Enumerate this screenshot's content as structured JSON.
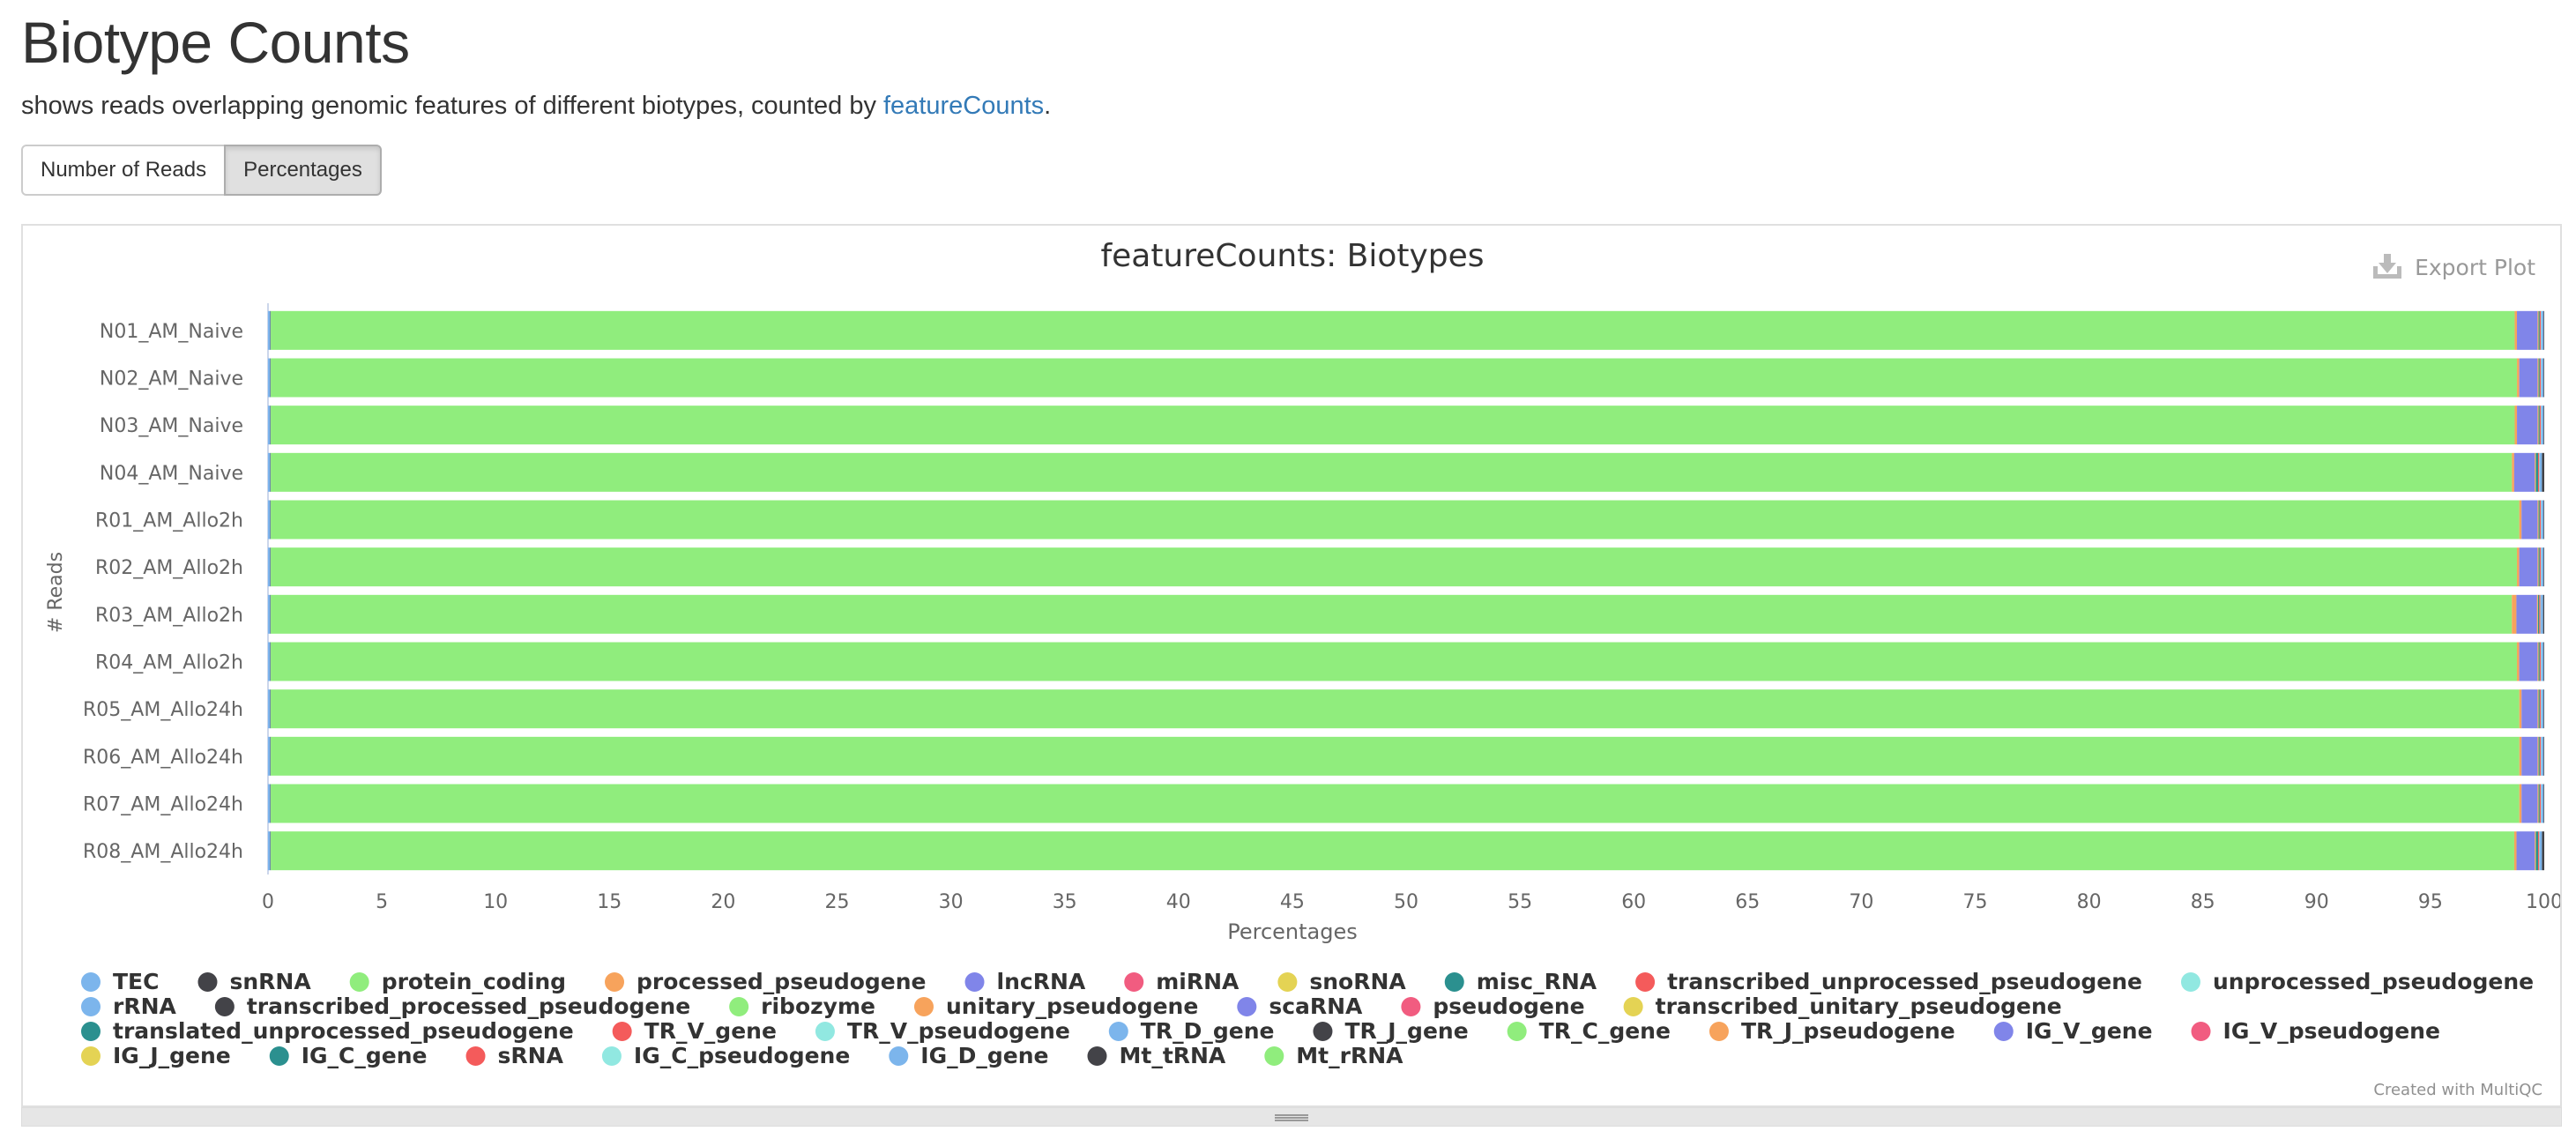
{
  "page": {
    "title": "Biotype Counts",
    "description_prefix": "shows reads overlapping genomic features of different biotypes, counted by ",
    "description_link": "featureCounts",
    "description_suffix": ".",
    "buttons": {
      "reads": "Number of Reads",
      "percentages": "Percentages"
    },
    "export_label": "Export Plot",
    "credit": "Created with MultiQC"
  },
  "chart_data": {
    "type": "bar",
    "orientation": "horizontal",
    "stacked": true,
    "title": "featureCounts: Biotypes",
    "xlabel": "Percentages",
    "ylabel": "# Reads",
    "xlim": [
      0,
      100
    ],
    "xticks": [
      0,
      5,
      10,
      15,
      20,
      25,
      30,
      35,
      40,
      45,
      50,
      55,
      60,
      65,
      70,
      75,
      80,
      85,
      90,
      95,
      100
    ],
    "categories": [
      "N01_AM_Naive",
      "N02_AM_Naive",
      "N03_AM_Naive",
      "N04_AM_Naive",
      "R01_AM_Allo2h",
      "R02_AM_Allo2h",
      "R03_AM_Allo2h",
      "R04_AM_Allo2h",
      "R05_AM_Allo24h",
      "R06_AM_Allo24h",
      "R07_AM_Allo24h",
      "R08_AM_Allo24h"
    ],
    "legend_position": "bottom",
    "series": [
      {
        "name": "TEC",
        "color": "#7cb5ec",
        "values": [
          0.1,
          0.1,
          0.1,
          0.1,
          0.1,
          0.1,
          0.1,
          0.1,
          0.1,
          0.1,
          0.1,
          0.1
        ]
      },
      {
        "name": "snRNA",
        "color": "#434348",
        "values": [
          0.02,
          0.02,
          0.02,
          0.02,
          0.02,
          0.02,
          0.02,
          0.02,
          0.02,
          0.02,
          0.02,
          0.02
        ]
      },
      {
        "name": "protein_coding",
        "color": "#90ed7d",
        "values": [
          98.6,
          98.8,
          98.7,
          98.4,
          98.9,
          98.7,
          98.2,
          98.6,
          99.0,
          99.1,
          99.0,
          98.7
        ]
      },
      {
        "name": "processed_pseudogene",
        "color": "#f7a35c",
        "values": [
          0.1,
          0.1,
          0.1,
          0.1,
          0.1,
          0.1,
          0.2,
          0.1,
          0.1,
          0.1,
          0.1,
          0.1
        ]
      },
      {
        "name": "lncRNA",
        "color": "#8085e9",
        "values": [
          0.9,
          0.8,
          0.9,
          0.9,
          0.7,
          0.8,
          0.9,
          0.8,
          0.7,
          0.7,
          0.7,
          0.8
        ]
      },
      {
        "name": "miRNA",
        "color": "#f15c80",
        "values": [
          0.02,
          0.02,
          0.02,
          0.02,
          0.02,
          0.02,
          0.02,
          0.02,
          0.02,
          0.02,
          0.02,
          0.02
        ]
      },
      {
        "name": "snoRNA",
        "color": "#e4d354",
        "values": [
          0.03,
          0.03,
          0.03,
          0.03,
          0.03,
          0.03,
          0.03,
          0.03,
          0.03,
          0.03,
          0.03,
          0.03
        ]
      },
      {
        "name": "misc_RNA",
        "color": "#2b908f",
        "values": [
          0.05,
          0.05,
          0.05,
          0.1,
          0.05,
          0.05,
          0.05,
          0.05,
          0.05,
          0.05,
          0.05,
          0.1
        ]
      },
      {
        "name": "transcribed_unprocessed_pseudogene",
        "color": "#f45b5b",
        "values": [
          0.05,
          0.05,
          0.05,
          0.05,
          0.05,
          0.05,
          0.05,
          0.05,
          0.05,
          0.05,
          0.05,
          0.05
        ]
      },
      {
        "name": "unprocessed_pseudogene",
        "color": "#91e8e1",
        "values": [
          0.02,
          0.02,
          0.02,
          0.02,
          0.02,
          0.02,
          0.02,
          0.02,
          0.02,
          0.02,
          0.02,
          0.02
        ]
      },
      {
        "name": "rRNA",
        "color": "#7cb5ec",
        "values": [
          0.1,
          0.1,
          0.1,
          0.1,
          0.1,
          0.1,
          0.1,
          0.1,
          0.1,
          0.1,
          0.1,
          0.1
        ]
      },
      {
        "name": "transcribed_processed_pseudogene",
        "color": "#434348",
        "values": [
          0.03,
          0.03,
          0.03,
          0.1,
          0.03,
          0.03,
          0.05,
          0.03,
          0.03,
          0.03,
          0.03,
          0.1
        ]
      },
      {
        "name": "ribozyme",
        "color": "#90ed7d",
        "values": [
          0,
          0,
          0,
          0,
          0,
          0,
          0,
          0,
          0,
          0,
          0,
          0
        ]
      },
      {
        "name": "unitary_pseudogene",
        "color": "#f7a35c",
        "values": [
          0,
          0,
          0,
          0,
          0,
          0,
          0,
          0,
          0,
          0,
          0,
          0
        ]
      },
      {
        "name": "scaRNA",
        "color": "#8085e9",
        "values": [
          0,
          0,
          0,
          0,
          0,
          0,
          0,
          0,
          0,
          0,
          0,
          0
        ]
      },
      {
        "name": "pseudogene",
        "color": "#f15c80",
        "values": [
          0,
          0,
          0,
          0,
          0,
          0,
          0,
          0,
          0,
          0,
          0,
          0
        ]
      },
      {
        "name": "transcribed_unitary_pseudogene",
        "color": "#e4d354",
        "values": [
          0,
          0,
          0,
          0,
          0,
          0,
          0,
          0,
          0,
          0,
          0,
          0
        ]
      },
      {
        "name": "translated_unprocessed_pseudogene",
        "color": "#2b908f",
        "values": [
          0,
          0,
          0,
          0,
          0,
          0,
          0,
          0,
          0,
          0,
          0,
          0
        ]
      },
      {
        "name": "TR_V_gene",
        "color": "#f45b5b",
        "values": [
          0,
          0,
          0,
          0,
          0,
          0,
          0,
          0,
          0,
          0,
          0,
          0
        ]
      },
      {
        "name": "TR_V_pseudogene",
        "color": "#91e8e1",
        "values": [
          0,
          0,
          0,
          0,
          0,
          0,
          0,
          0,
          0,
          0,
          0,
          0
        ]
      },
      {
        "name": "TR_D_gene",
        "color": "#7cb5ec",
        "values": [
          0,
          0,
          0,
          0,
          0,
          0,
          0,
          0,
          0,
          0,
          0,
          0
        ]
      },
      {
        "name": "TR_J_gene",
        "color": "#434348",
        "values": [
          0,
          0,
          0,
          0,
          0,
          0,
          0,
          0,
          0,
          0,
          0,
          0
        ]
      },
      {
        "name": "TR_C_gene",
        "color": "#90ed7d",
        "values": [
          0,
          0,
          0,
          0,
          0,
          0,
          0,
          0,
          0,
          0,
          0,
          0
        ]
      },
      {
        "name": "TR_J_pseudogene",
        "color": "#f7a35c",
        "values": [
          0,
          0,
          0,
          0,
          0,
          0,
          0,
          0,
          0,
          0,
          0,
          0
        ]
      },
      {
        "name": "IG_V_gene",
        "color": "#8085e9",
        "values": [
          0,
          0,
          0,
          0,
          0,
          0,
          0,
          0,
          0,
          0,
          0,
          0
        ]
      },
      {
        "name": "IG_V_pseudogene",
        "color": "#f15c80",
        "values": [
          0,
          0,
          0,
          0,
          0,
          0,
          0,
          0,
          0,
          0,
          0,
          0
        ]
      },
      {
        "name": "IG_J_gene",
        "color": "#e4d354",
        "values": [
          0,
          0,
          0,
          0,
          0,
          0,
          0,
          0,
          0,
          0,
          0,
          0
        ]
      },
      {
        "name": "IG_C_gene",
        "color": "#2b908f",
        "values": [
          0,
          0,
          0,
          0,
          0,
          0,
          0,
          0,
          0,
          0,
          0,
          0
        ]
      },
      {
        "name": "sRNA",
        "color": "#f45b5b",
        "values": [
          0,
          0,
          0,
          0,
          0,
          0,
          0,
          0,
          0,
          0,
          0,
          0
        ]
      },
      {
        "name": "IG_C_pseudogene",
        "color": "#91e8e1",
        "values": [
          0,
          0,
          0,
          0,
          0,
          0,
          0,
          0,
          0,
          0,
          0,
          0
        ]
      },
      {
        "name": "IG_D_gene",
        "color": "#7cb5ec",
        "values": [
          0,
          0,
          0,
          0,
          0,
          0,
          0,
          0,
          0,
          0,
          0,
          0
        ]
      },
      {
        "name": "Mt_tRNA",
        "color": "#434348",
        "values": [
          0,
          0,
          0,
          0,
          0,
          0,
          0,
          0,
          0,
          0,
          0,
          0
        ]
      },
      {
        "name": "Mt_rRNA",
        "color": "#90ed7d",
        "values": [
          0,
          0,
          0,
          0,
          0,
          0,
          0,
          0,
          0,
          0,
          0,
          0
        ]
      }
    ]
  }
}
